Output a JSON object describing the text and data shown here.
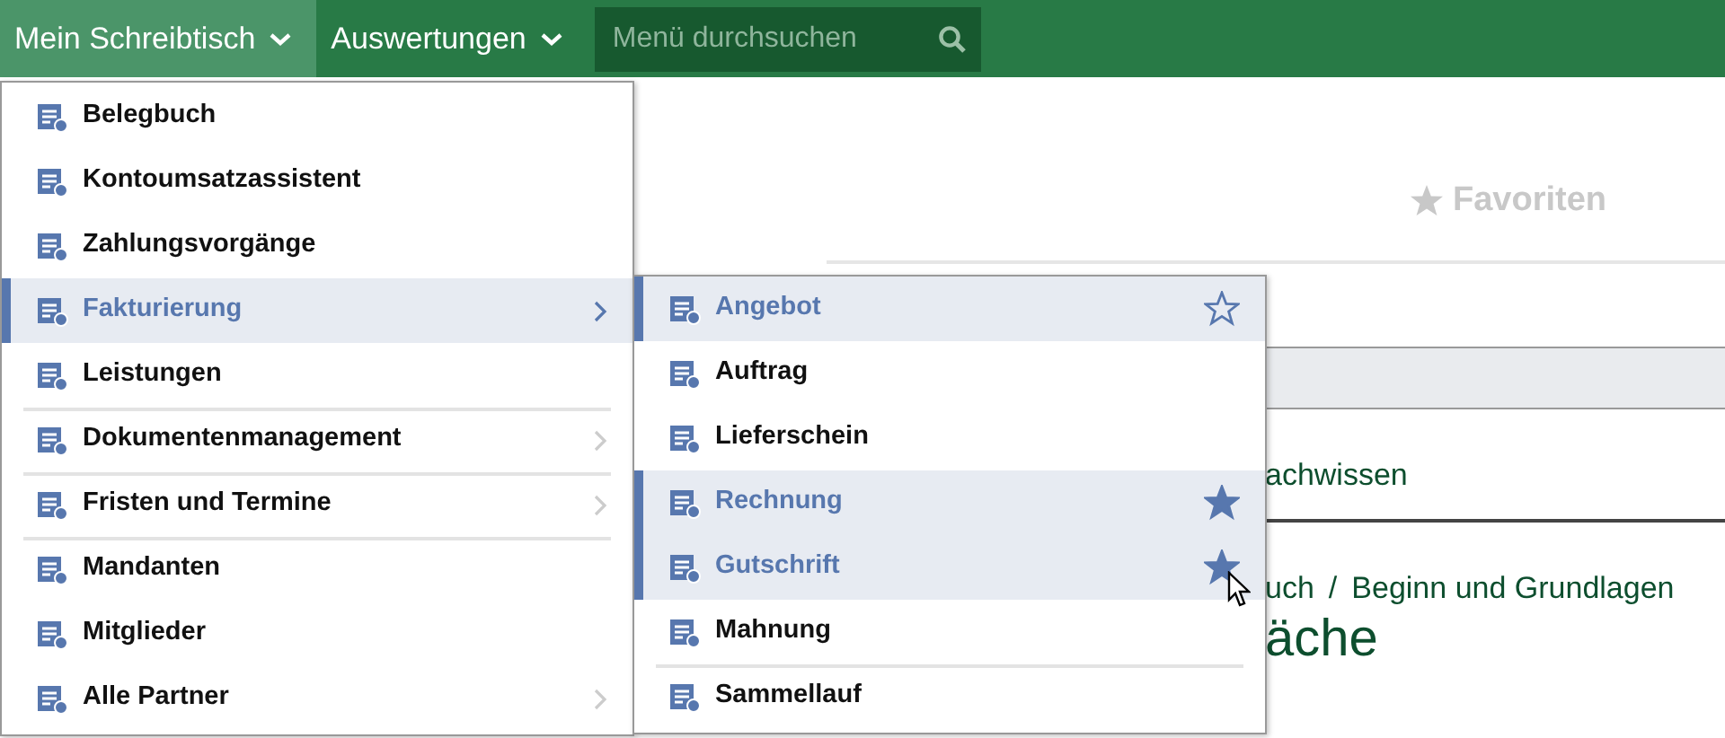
{
  "top_menu": [
    {
      "label": "Mein Schreibtisch",
      "selected": true
    },
    {
      "label": "Auswertungen",
      "selected": false
    }
  ],
  "search": {
    "placeholder": "Menü durchsuchen"
  },
  "favorites": {
    "label": "Favoriten"
  },
  "background": {
    "link": "achwissen",
    "breadcrumb": [
      "uch",
      "Beginn und Grundlagen"
    ],
    "breadcrumb_separator": "/",
    "heading": "äche"
  },
  "menu": [
    {
      "label": "Belegbuch",
      "selected": false,
      "submenu": false,
      "divider": false
    },
    {
      "label": "Kontoumsatzassistent",
      "selected": false,
      "submenu": false,
      "divider": false
    },
    {
      "label": "Zahlungsvorgänge",
      "selected": false,
      "submenu": false,
      "divider": false
    },
    {
      "label": "Fakturierung",
      "selected": true,
      "submenu": true,
      "divider": false
    },
    {
      "label": "Leistungen",
      "selected": false,
      "submenu": false,
      "divider": false
    },
    {
      "label": "Dokumentenmanagement",
      "selected": false,
      "submenu": true,
      "divider": true
    },
    {
      "label": "Fristen und Termine",
      "selected": false,
      "submenu": true,
      "divider": true
    },
    {
      "label": "Mandanten",
      "selected": false,
      "submenu": false,
      "divider": true
    },
    {
      "label": "Mitglieder",
      "selected": false,
      "submenu": false,
      "divider": false
    },
    {
      "label": "Alle Partner",
      "selected": false,
      "submenu": true,
      "divider": false
    }
  ],
  "submenu": [
    {
      "label": "Angebot",
      "selected": true,
      "divider": false,
      "starred": false
    },
    {
      "label": "Auftrag",
      "selected": false,
      "divider": false
    },
    {
      "label": "Lieferschein",
      "selected": false,
      "divider": false
    },
    {
      "label": "Rechnung",
      "selected": true,
      "divider": false,
      "starred": true
    },
    {
      "label": "Gutschrift",
      "selected": true,
      "divider": false,
      "starred": true
    },
    {
      "label": "Mahnung",
      "selected": false,
      "divider": false
    },
    {
      "label": "Sammellauf",
      "selected": false,
      "divider": true
    }
  ]
}
